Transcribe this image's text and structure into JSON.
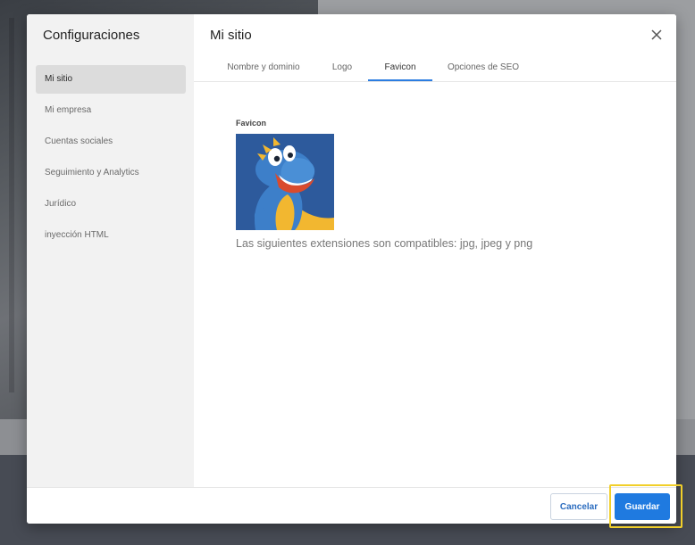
{
  "sidebar": {
    "title": "Configuraciones",
    "items": [
      {
        "label": "Mi sitio"
      },
      {
        "label": "Mi empresa"
      },
      {
        "label": "Cuentas sociales"
      },
      {
        "label": "Seguimiento y Analytics"
      },
      {
        "label": "Jurídico"
      },
      {
        "label": "inyección HTML"
      }
    ],
    "active_index": 0
  },
  "main": {
    "title": "Mi sitio",
    "tabs": [
      {
        "label": "Nombre y dominio"
      },
      {
        "label": "Logo"
      },
      {
        "label": "Favicon"
      },
      {
        "label": "Opciones de SEO"
      }
    ],
    "active_tab": "Favicon",
    "favicon": {
      "label": "Favicon",
      "image": "gator-mascot",
      "help_text": "Las siguientes extensiones son compatibles: jpg, jpeg y png"
    }
  },
  "footer": {
    "cancel_label": "Cancelar",
    "save_label": "Guardar"
  },
  "icons": {
    "close": "close-icon"
  },
  "colors": {
    "accent": "#1f7ae0",
    "highlight": "#f1cf2a",
    "sidebar_bg": "#f2f2f2"
  }
}
